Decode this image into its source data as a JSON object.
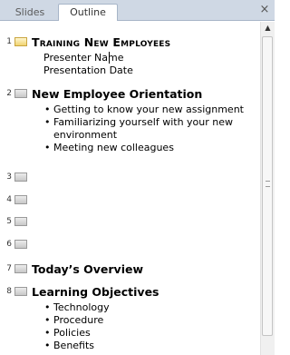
{
  "tabs": {
    "slides": "Slides",
    "outline": "Outline",
    "close": "×"
  },
  "slides": [
    {
      "num": "1",
      "title": "Training New Employees",
      "lines": [
        "Presenter Name",
        "Presentation Date"
      ]
    },
    {
      "num": "2",
      "title": "New Employee Orientation",
      "bullets": [
        "Getting to know your new assignment",
        "Familiarizing yourself with your new",
        "environment",
        "Meeting new colleagues"
      ]
    },
    {
      "num": "3"
    },
    {
      "num": "4"
    },
    {
      "num": "5"
    },
    {
      "num": "6"
    },
    {
      "num": "7",
      "title": "Today’s Overview"
    },
    {
      "num": "8",
      "title": "Learning Objectives",
      "bullets": [
        "Technology",
        "Procedure",
        "Policies",
        "Benefits"
      ]
    }
  ],
  "bullet_char": "•",
  "scroll_up_glyph": "▲"
}
